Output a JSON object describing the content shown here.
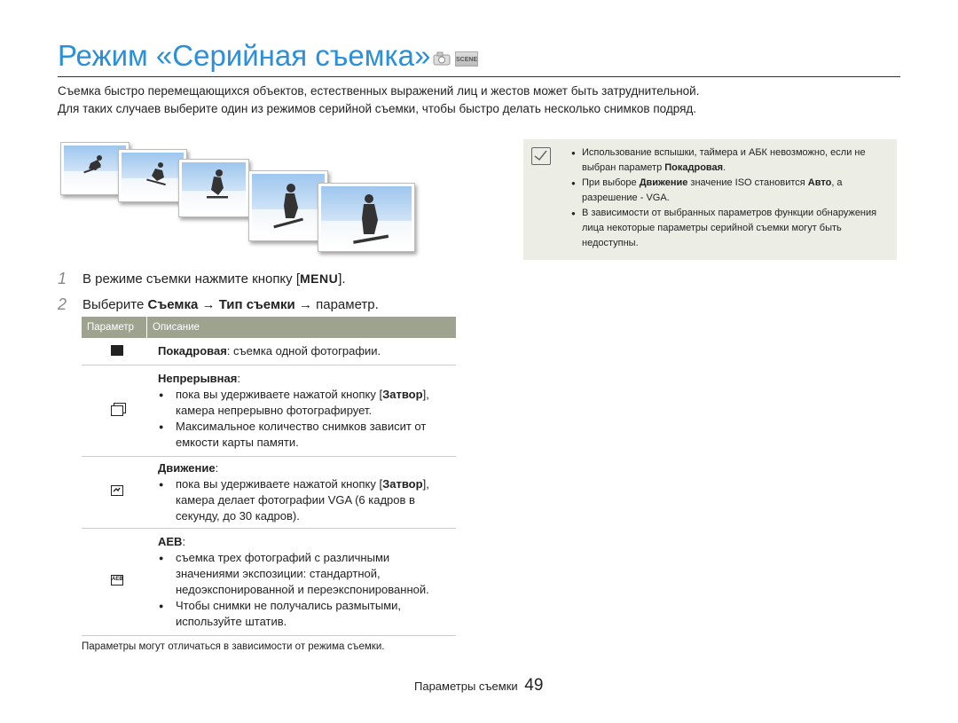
{
  "page": {
    "title": "Режим «Серийная съемка»",
    "title_icons": [
      "camera-icon",
      "scene-icon"
    ],
    "scene_icon_label": "SCENE",
    "intro": [
      "Съемка быстро перемещающихся объектов, естественных выражений лиц и жестов может быть затруднительной.",
      "Для таких случаев выберите один из режимов серийной съемки, чтобы быстро делать несколько снимков подряд."
    ]
  },
  "steps": [
    {
      "num": "1",
      "pre": "В режиме съемки нажмите кнопку [",
      "key": "MENU",
      "post": "]."
    },
    {
      "num": "2",
      "pre": "Выберите ",
      "b1": "Съемка",
      "arrow1": " → ",
      "b2": "Тип съемки",
      "post": " → параметр."
    }
  ],
  "table": {
    "headers": [
      "Параметр",
      "Описание"
    ],
    "rows": [
      {
        "icon": "single-shot-icon",
        "name": "Покадровая",
        "text": ": съемка одной фотографии."
      },
      {
        "icon": "continuous-icon",
        "name": "Непрерывная",
        "colon": ":",
        "b1_pre": "пока вы удерживаете нажатой кнопку [",
        "b1_key": "Затвор",
        "b1_post": "], камера непрерывно фотографирует.",
        "b2": "Максимальное количество снимков зависит от емкости карты памяти."
      },
      {
        "icon": "motion-icon",
        "name": "Движение",
        "colon": ":",
        "b1_pre": "пока вы удерживаете нажатой кнопку [",
        "b1_key": "Затвор",
        "b1_post": "], камера делает фотографии VGA (6 кадров в секунду, до 30 кадров)."
      },
      {
        "icon": "aeb-icon",
        "name": "AEB",
        "colon": ":",
        "b1": "съемка трех фотографий с различными значениями экспозиции: стандартной, недоэкспонированной и переэкспонированной.",
        "b2": "Чтобы снимки не получались размытыми, используйте штатив."
      }
    ],
    "aeb_icon_label": "AEB"
  },
  "note": "Параметры могут отличаться в зависимости от режима съемки.",
  "sidebox": {
    "icon": "note-icon",
    "b1_pre": "Использование вспышки, таймера и АБК невозможно, если не выбран параметр ",
    "b1_bold": "Покадровая",
    "b1_post": ".",
    "b2_pre": "При выборе ",
    "b2_bold1": "Движение",
    "b2_mid": " значение ISO становится ",
    "b2_bold2": "Авто",
    "b2_post": ", а разрешение - VGA.",
    "b3": "В зависимости от выбранных параметров функции обнаружения лица некоторые параметры серийной съемки могут быть недоступны."
  },
  "footer": {
    "section": "Параметры съемки",
    "page": "49"
  }
}
